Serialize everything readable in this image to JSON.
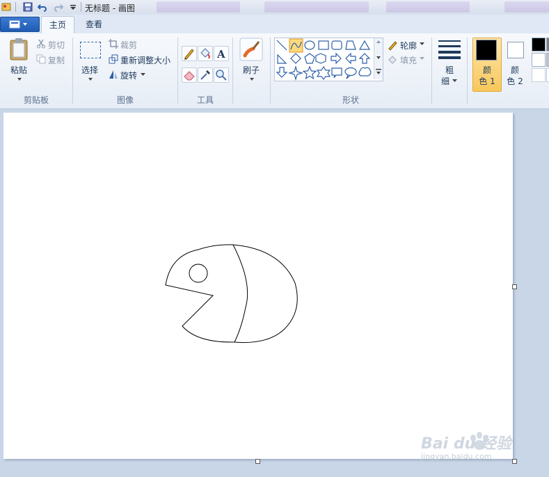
{
  "window": {
    "title": "无标题 - 画图"
  },
  "tabs": [
    {
      "label": "主页",
      "active": true
    },
    {
      "label": "查看",
      "active": false
    }
  ],
  "clipboard": {
    "paste": "粘贴",
    "cut": "剪切",
    "copy": "复制",
    "group": "剪贴板"
  },
  "image": {
    "select": "选择",
    "crop": "裁剪",
    "resize": "重新调整大小",
    "rotate": "旋转",
    "group": "图像"
  },
  "tools": {
    "group": "工具"
  },
  "brushes": {
    "label": "刷子"
  },
  "shapes": {
    "group": "形状",
    "outline": "轮廓",
    "fill": "填充"
  },
  "size": {
    "label1": "粗",
    "label2": "细"
  },
  "colors": {
    "color1_a": "颜",
    "color1_b": "色 1",
    "color2_a": "颜",
    "color2_b": "色 2",
    "color1_value": "#000000",
    "color2_value": "#ffffff"
  },
  "watermark": {
    "brand": "Bai du 经验",
    "url": "jingyan.baidu.com"
  }
}
